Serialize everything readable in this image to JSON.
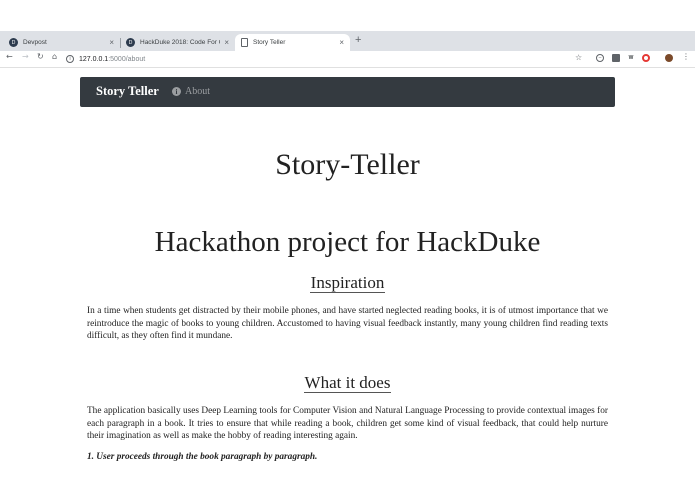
{
  "browser": {
    "tabs": [
      {
        "title": "Devpost",
        "favicon": "devpost-icon",
        "active": false
      },
      {
        "title": "HackDuke 2018: Code For Goo",
        "favicon": "devpost-icon",
        "active": false
      },
      {
        "title": "Story Teller",
        "favicon": "document-icon",
        "active": true
      }
    ],
    "new_tab_glyph": "+",
    "close_glyph": "×",
    "url_host": "127.0.0.1",
    "url_path": ":5000/about"
  },
  "navbar": {
    "brand": "Story Teller",
    "about_label": "About",
    "bg_color": "#343a40"
  },
  "page": {
    "site_title": "Story-Teller",
    "project_title": "Hackathon project for HackDuke",
    "sections": [
      {
        "heading": "Inspiration",
        "body": "In a time when students get distracted by their mobile phones, and have started neglected reading books, it is of utmost importance that we reintroduce the magic of books to young children. Accustomed to having visual feedback instantly, many young children find reading texts difficult, as they often find it mundane."
      },
      {
        "heading": "What it does",
        "body": "The application basically uses Deep Learning tools for Computer Vision and Natural Language Processing to provide contextual images for each paragraph in a book. It tries to ensure that while reading a book, children get some kind of visual feedback, that could help nurture their imagination as well as make the hobby of reading interesting again."
      }
    ],
    "step_1": "1. User proceeds through the book paragraph by paragraph."
  }
}
